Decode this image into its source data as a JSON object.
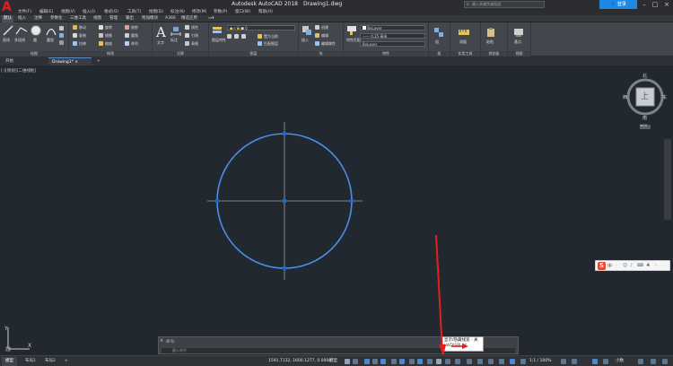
{
  "titlebar": {
    "app": "Autodesk AutoCAD 2018",
    "file": "Drawing1.dwg",
    "search_placeholder": "键入关键字或短语",
    "user": "登录"
  },
  "menubar": {
    "items": [
      "文件(F)",
      "编辑(E)",
      "视图(V)",
      "插入(I)",
      "格式(O)",
      "工具(T)",
      "绘图(D)",
      "标注(N)",
      "修改(M)",
      "参数(P)",
      "窗口(W)",
      "帮助(H)"
    ]
  },
  "ribbon_tabs": {
    "items": [
      "默认",
      "插入",
      "注释",
      "参数化",
      "三维工具",
      "视图",
      "管理",
      "输出",
      "附加模块",
      "A360",
      "精选应用"
    ],
    "active": "默认"
  },
  "ribbon": {
    "panels": {
      "draw": "绘图",
      "modify": "修改",
      "annotation": "注释",
      "layers": "图层",
      "block": "块",
      "properties": "特性",
      "groups": "组",
      "utilities": "实用工具",
      "clipboard": "剪贴板",
      "view": "视图"
    },
    "draw_tools": {
      "line": "直线",
      "polyline": "多段线",
      "circle": "圆",
      "arc": "圆弧"
    },
    "modify_tools": {
      "move": "移动",
      "rotate": "旋转",
      "trim": "修剪",
      "copy": "复制",
      "mirror": "镜像",
      "fillet": "圆角",
      "stretch": "拉伸",
      "scale": "缩放",
      "array": "阵列"
    },
    "annotation_tools": {
      "text": "文字",
      "dimension": "标注",
      "linear": "线性",
      "leader": "引线",
      "table": "表格"
    },
    "layer_tools": {
      "layer_props": "图层特性",
      "layer_value": "0",
      "make_current": "置为当前",
      "match_layer": "匹配图层"
    },
    "block_tools": {
      "insert": "插入",
      "create": "创建",
      "edit": "编辑",
      "edit_attr": "编辑属性"
    },
    "properties_tools": {
      "match": "特性匹配",
      "color": "ByLayer",
      "lineweight": "—— 0.25 毫米",
      "linetype": "ByLayer"
    },
    "groups_tools": {
      "group": "组"
    },
    "utilities_tools": {
      "measure": "测量"
    },
    "clipboard_tools": {
      "paste": "粘贴"
    },
    "view_tools": {
      "base": "基点"
    }
  },
  "file_tabs": {
    "items": [
      "开始",
      "Drawing1*"
    ],
    "active": "Drawing1*"
  },
  "canvas": {
    "viewport_label": "[-][俯视][二维线框]",
    "viewcube": {
      "top": "上",
      "north": "北",
      "south": "南",
      "east": "东",
      "west": "西",
      "wcs": "WCS"
    }
  },
  "command_line": {
    "history": "命令:",
    "placeholder": "键入命令"
  },
  "tooltip": {
    "title": "显示/隐藏线宽 - 关",
    "code": "LWDISPLAY"
  },
  "statusbar": {
    "layout_tabs": [
      "模型",
      "布局1",
      "布局2"
    ],
    "active_tab": "模型",
    "coords": "1591.7132, 1600.1277, 0.0000",
    "mode": "模型",
    "scale": "1:1 / 100%",
    "units": "小数"
  },
  "ime": {
    "logo": "S",
    "lang": "中"
  },
  "colors": {
    "canvas_bg": "#212830",
    "circle": "#4d8fe3",
    "crosshair": "#9aa0a6",
    "grip": "#1e64d0",
    "annotation_arrow": "#e3201b"
  }
}
